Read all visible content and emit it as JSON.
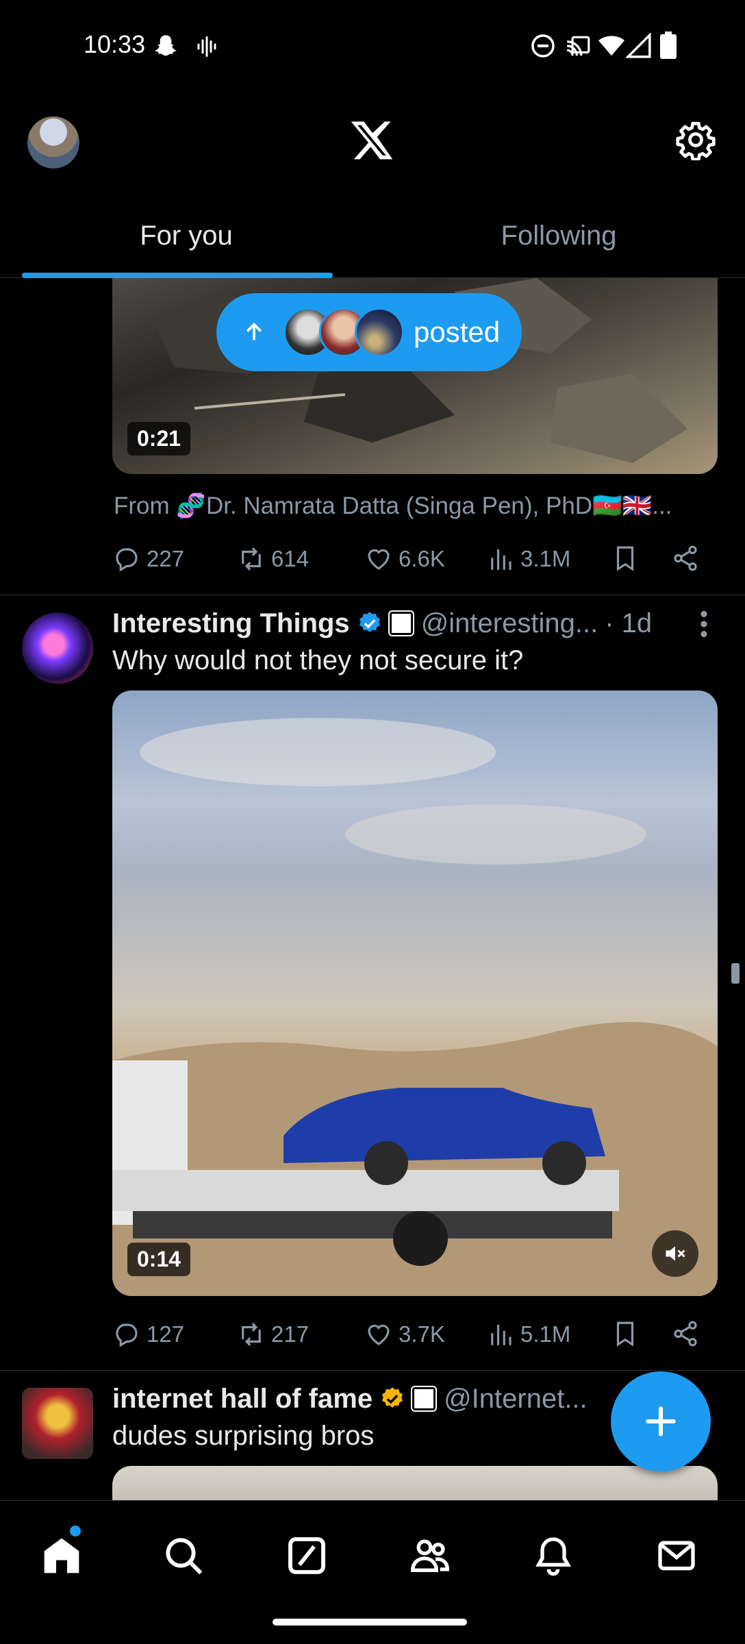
{
  "status_bar": {
    "time": "10:33"
  },
  "tabs": [
    {
      "label": "For you",
      "active": true
    },
    {
      "label": "Following",
      "active": false
    }
  ],
  "posted_pill": {
    "label": "posted"
  },
  "post1": {
    "duration": "0:21",
    "from_text": "From 🧬Dr. Namrata Datta (Singa Pen), PhD🇦🇿🇬🇧...",
    "replies": "227",
    "reposts": "614",
    "likes": "6.6K",
    "views": "3.1M"
  },
  "post2": {
    "name": "Interesting Things",
    "handle": "@interesting...",
    "time": "· 1d",
    "text": "Why would not they not secure it?",
    "duration": "0:14",
    "replies": "127",
    "reposts": "217",
    "likes": "3.7K",
    "views": "5.1M"
  },
  "post3": {
    "name": "internet hall of fame",
    "handle": "@Internet...",
    "text": "dudes surprising bros"
  },
  "colors": {
    "accent": "#1d9bf0",
    "gold_badge": "#f4b400",
    "muted": "#8b98a5"
  },
  "icons": {
    "nav": [
      "home-icon",
      "search-icon",
      "grok-icon",
      "communities-icon",
      "notifications-icon",
      "messages-icon"
    ],
    "header": [
      "x-logo-icon",
      "gear-icon"
    ]
  }
}
